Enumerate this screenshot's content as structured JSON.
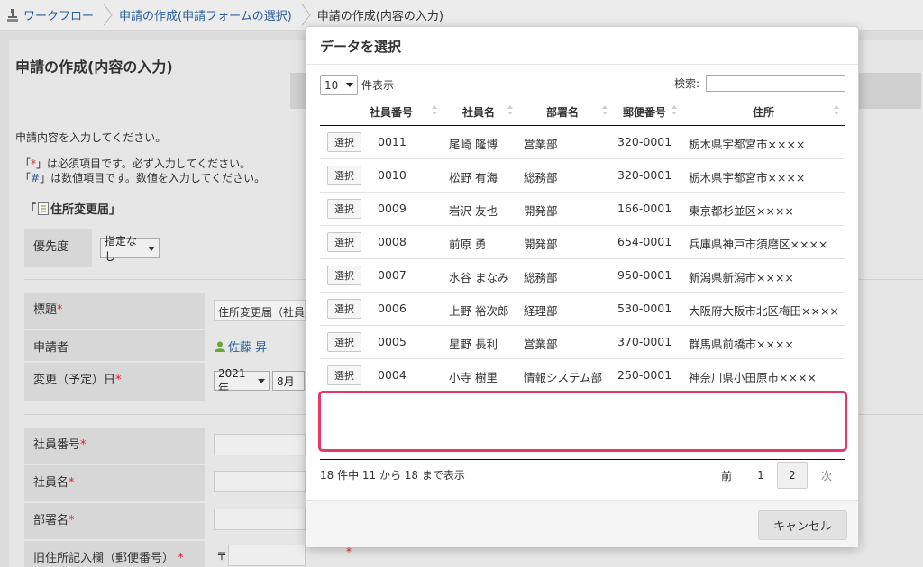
{
  "breadcrumb": {
    "items": [
      {
        "label": "ワークフロー"
      },
      {
        "label": "申請の作成(申請フォームの選択)"
      },
      {
        "label": "申請の作成(内容の入力)"
      }
    ]
  },
  "page": {
    "title": "申請の作成(内容の入力)",
    "intro": "申請内容を入力してください。",
    "note_required_open": "「",
    "note_required_mark": "*",
    "note_required_text": "」は必須項目です。必ず入力してください。",
    "note_numeric_open": "「",
    "note_numeric_mark": "#",
    "note_numeric_text": "」は数値項目です。数値を入力してください。",
    "form_name_open": "「",
    "form_name": "住所変更届",
    "form_name_close": "」",
    "priority_label": "優先度",
    "priority_value": "指定なし",
    "subject_label": "標題",
    "subject_value": "住所変更届（社員名",
    "applicant_label": "申請者",
    "applicant_value": "佐藤 昇",
    "change_date_label": "変更（予定）日",
    "year_value": "2021年",
    "month_value": "8月",
    "employee_no_label": "社員番号",
    "employee_name_label": "社員名",
    "department_label": "部署名",
    "old_address_label": "旧住所記入欄（郵便番号）",
    "postal_mark": "〒",
    "required_mark": "*"
  },
  "modal": {
    "title": "データを選択",
    "length_value": "10",
    "length_label": "件表示",
    "search_label": "検索:",
    "search_value": "",
    "columns": [
      "社員番号",
      "社員名",
      "部署名",
      "郵便番号",
      "住所"
    ],
    "select_label": "選択",
    "rows": [
      {
        "id": "0011",
        "name": "尾崎 隆博",
        "dept": "営業部",
        "zip": "320-0001",
        "address": "栃木県宇都宮市××××"
      },
      {
        "id": "0010",
        "name": "松野 有海",
        "dept": "総務部",
        "zip": "320-0001",
        "address": "栃木県宇都宮市××××"
      },
      {
        "id": "0009",
        "name": "岩沢 友也",
        "dept": "開発部",
        "zip": "166-0001",
        "address": "東京都杉並区××××"
      },
      {
        "id": "0008",
        "name": "前原 勇",
        "dept": "開発部",
        "zip": "654-0001",
        "address": "兵庫県神戸市須磨区××××"
      },
      {
        "id": "0007",
        "name": "水谷 まなみ",
        "dept": "総務部",
        "zip": "950-0001",
        "address": "新潟県新潟市××××"
      },
      {
        "id": "0006",
        "name": "上野 裕次郎",
        "dept": "経理部",
        "zip": "530-0001",
        "address": "大阪府大阪市北区梅田××××"
      },
      {
        "id": "0005",
        "name": "星野 長利",
        "dept": "営業部",
        "zip": "370-0001",
        "address": "群馬県前橋市××××"
      },
      {
        "id": "0004",
        "name": "小寺 樹里",
        "dept": "情報システム部",
        "zip": "250-0001",
        "address": "神奈川県小田原市××××"
      }
    ],
    "info": "18 件中 11 から 18 まで表示",
    "pager": {
      "prev": "前",
      "page1": "1",
      "page2": "2",
      "next": "次"
    },
    "cancel_label": "キャンセル"
  },
  "colors": {
    "accent": "#2a5f9e",
    "highlight": "#e8386a",
    "required": "#dd2233"
  }
}
